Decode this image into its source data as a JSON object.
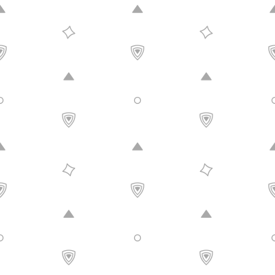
{
  "pattern": {
    "background_color": "#ffffff",
    "stroke_color": "#a9a9a9",
    "fill_color": "#a9a9a9",
    "motifs": [
      "triangle-icon",
      "sparkle-icon",
      "shield-icon",
      "circle-icon"
    ]
  }
}
